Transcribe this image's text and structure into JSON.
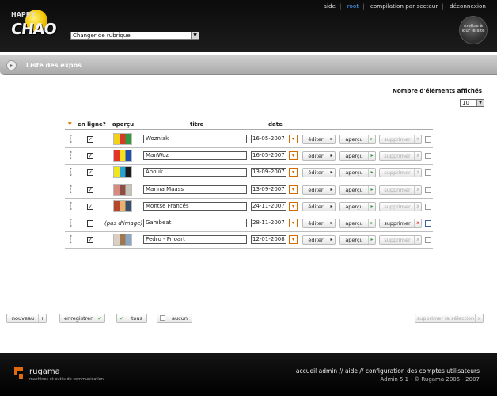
{
  "header": {
    "logo_top": "HAPPY",
    "logo_text": "CHAO",
    "rubrique_select": "Changer de rubrique",
    "nav": [
      "aide",
      "root",
      "compilation par secteur",
      "déconnexion"
    ],
    "nav_active": "root",
    "update_button": "mettre à jour le site"
  },
  "section": {
    "title": "Liste des expos"
  },
  "count": {
    "label": "Nombre d'éléments affichés",
    "value": "10"
  },
  "table": {
    "headers": {
      "online": "en ligne?",
      "preview": "aperçu",
      "title": "titre",
      "date": "date"
    },
    "buttons": {
      "edit": "éditer",
      "preview": "aperçu",
      "delete": "supprimer"
    },
    "no_image": "(pas d'image)",
    "rows": [
      {
        "title": "Wozniak",
        "date": "16-05-2007",
        "online": true,
        "has_image": true,
        "colors": [
          "#f0d21a",
          "#d63a2a",
          "#2f9a3f"
        ]
      },
      {
        "title": "ManWoz",
        "date": "16-05-2007",
        "online": true,
        "has_image": true,
        "colors": [
          "#e53327",
          "#f7e11c",
          "#1f4eb1"
        ]
      },
      {
        "title": "Anouk",
        "date": "13-09-2007",
        "online": true,
        "has_image": true,
        "colors": [
          "#f1e51d",
          "#27a1d3",
          "#1b1b1b"
        ]
      },
      {
        "title": "Marina Maass",
        "date": "13-09-2007",
        "online": true,
        "has_image": true,
        "colors": [
          "#d78a7d",
          "#8b4e45",
          "#c7c2b6"
        ]
      },
      {
        "title": "Montse Francés",
        "date": "24-11-2007",
        "online": true,
        "has_image": true,
        "colors": [
          "#b5452d",
          "#e9b06e",
          "#39506c"
        ]
      },
      {
        "title": "Gambeat",
        "date": "28-11-2007",
        "online": false,
        "has_image": false,
        "colors": []
      },
      {
        "title": " Pedro - Prioart",
        "date": "12-01-2008",
        "online": true,
        "has_image": true,
        "colors": [
          "#d9d0c3",
          "#a07850",
          "#8aa6c4"
        ]
      }
    ]
  },
  "bottom": {
    "new": "nouveau",
    "save": "enregistrer",
    "all": "tous",
    "none": "aucun",
    "delete_selection": "supprimer la sélection"
  },
  "footer": {
    "brand": "rugama",
    "tagline": "machines et outils de communication",
    "links": "accueil admin // aide // configuration des comptes utilisateurs",
    "version": "Admin 5.1 - © Rugama 2005 - 2007"
  }
}
